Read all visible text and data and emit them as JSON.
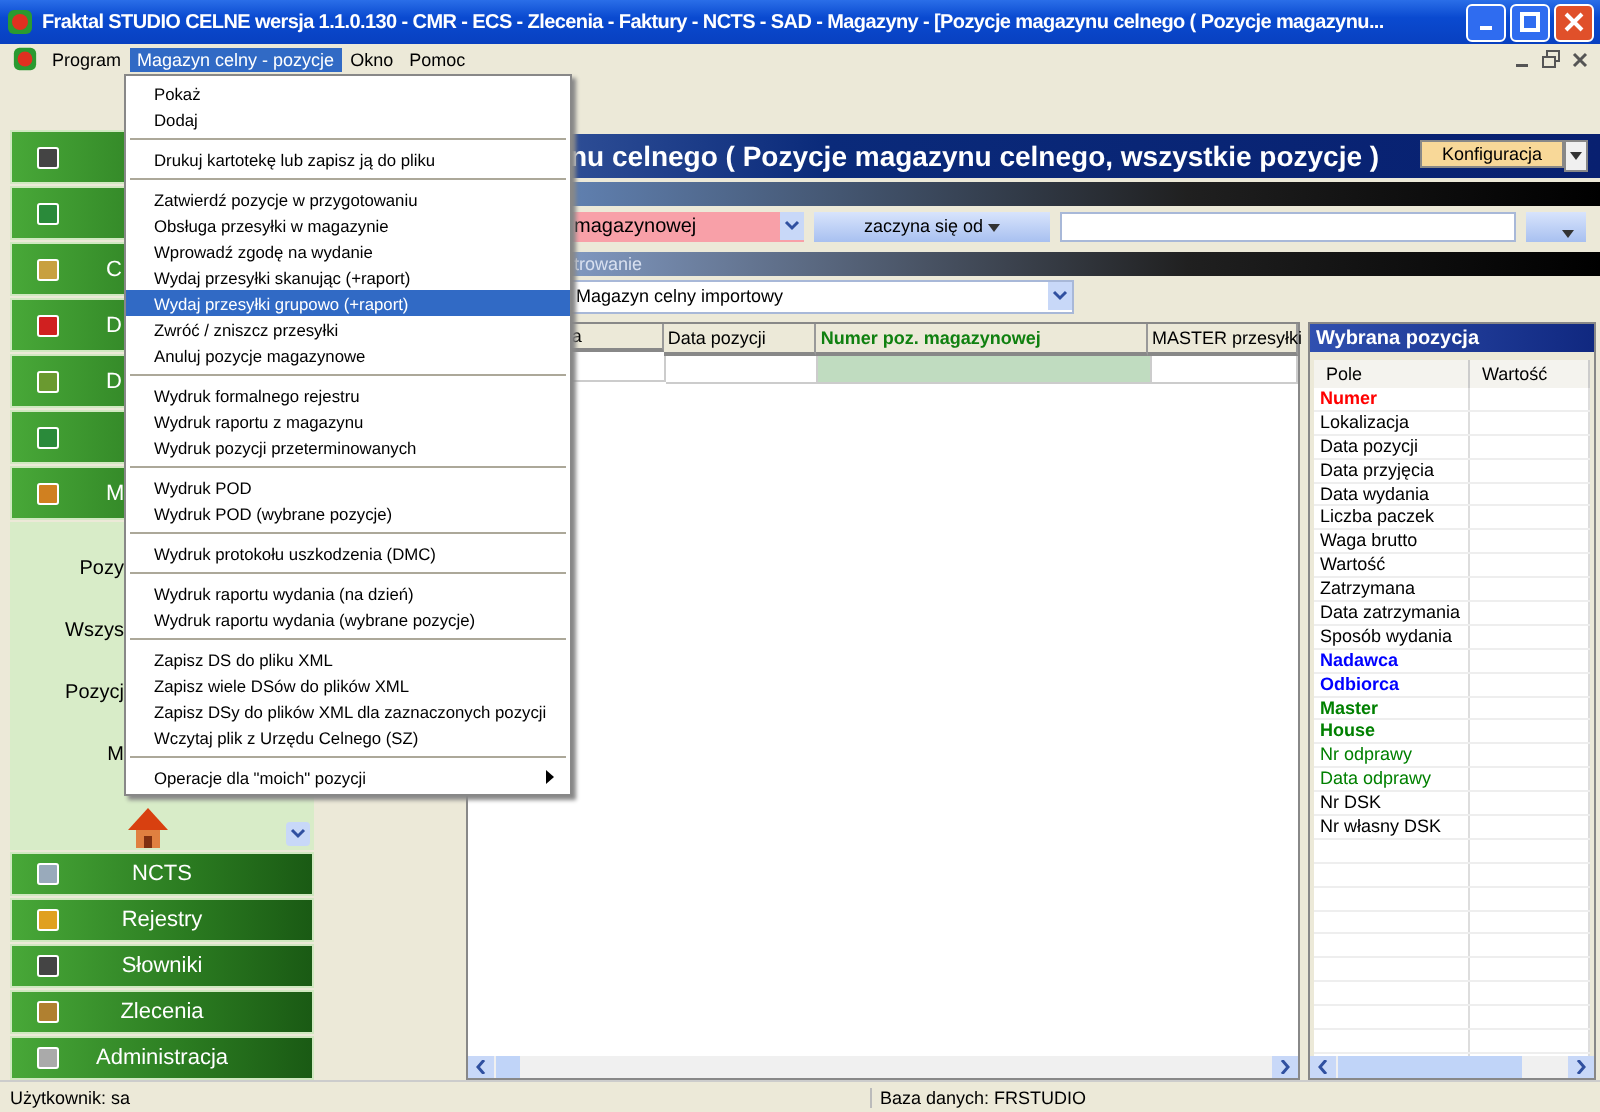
{
  "window": {
    "title": "Fraktal STUDIO CELNE  wersja 1.1.0.130 - CMR - ECS - Zlecenia - Faktury - NCTS - SAD - Magazyny - [Pozycje magazynu celnego ( Pozycje magazynu..."
  },
  "menubar": [
    {
      "label": "Program",
      "selected": false
    },
    {
      "label": "Magazyn celny - pozycje",
      "selected": true
    },
    {
      "label": "Okno",
      "selected": false
    },
    {
      "label": "Pomoc",
      "selected": false
    }
  ],
  "menu": {
    "groups": [
      [
        {
          "label": "Pokaż",
          "selected": false,
          "submenu": false
        },
        {
          "label": "Dodaj",
          "selected": false,
          "submenu": false
        }
      ],
      [
        {
          "label": "Drukuj kartotekę lub zapisz ją do pliku",
          "selected": false,
          "submenu": false
        }
      ],
      [
        {
          "label": "Zatwierdź pozycje w przygotowaniu",
          "selected": false,
          "submenu": false
        },
        {
          "label": "Obsługa przesyłki w magazynie",
          "selected": false,
          "submenu": false
        },
        {
          "label": "Wprowadź zgodę na wydanie",
          "selected": false,
          "submenu": false
        },
        {
          "label": "Wydaj przesyłki skanując (+raport)",
          "selected": false,
          "submenu": false
        },
        {
          "label": "Wydaj przesyłki grupowo (+raport)",
          "selected": true,
          "submenu": false
        },
        {
          "label": "Zwróć / zniszcz przesyłki",
          "selected": false,
          "submenu": false
        },
        {
          "label": "Anuluj pozycje magazynowe",
          "selected": false,
          "submenu": false
        }
      ],
      [
        {
          "label": "Wydruk formalnego rejestru",
          "selected": false,
          "submenu": false
        },
        {
          "label": "Wydruk raportu z magazynu",
          "selected": false,
          "submenu": false
        },
        {
          "label": "Wydruk pozycji przeterminowanych",
          "selected": false,
          "submenu": false
        }
      ],
      [
        {
          "label": "Wydruk POD",
          "selected": false,
          "submenu": false
        },
        {
          "label": "Wydruk POD (wybrane pozycje)",
          "selected": false,
          "submenu": false
        }
      ],
      [
        {
          "label": "Wydruk protokołu uszkodzenia (DMC)",
          "selected": false,
          "submenu": false
        }
      ],
      [
        {
          "label": "Wydruk raportu wydania (na dzień)",
          "selected": false,
          "submenu": false
        },
        {
          "label": "Wydruk raportu wydania (wybrane pozycje)",
          "selected": false,
          "submenu": false
        }
      ],
      [
        {
          "label": "Zapisz DS do pliku XML",
          "selected": false,
          "submenu": false
        },
        {
          "label": "Zapisz wiele DSów do plików XML",
          "selected": false,
          "submenu": false
        },
        {
          "label": "Zapisz DSy do plików XML dla zaznaczonych pozycji",
          "selected": false,
          "submenu": false
        },
        {
          "label": "Wczytaj plik z Urzędu Celnego (SZ)",
          "selected": false,
          "submenu": false
        }
      ],
      [
        {
          "label": "Operacje dla \"moich\" pozycji",
          "selected": false,
          "submenu": true
        }
      ]
    ]
  },
  "sidebar": {
    "top_buttons": [
      {
        "kind": "document"
      },
      {
        "kind": "picture"
      },
      {
        "kind": "bell",
        "label": "C"
      },
      {
        "kind": "cmr",
        "label": "D"
      },
      {
        "kind": "clipboard",
        "label": "D"
      },
      {
        "kind": "picture"
      },
      {
        "kind": "lock",
        "label": "M"
      }
    ],
    "panel_texts": [
      "Pozy",
      "Wszys",
      "Pozycj",
      "M"
    ],
    "bottom_buttons": [
      {
        "kind": "mail",
        "label": "NCTS"
      },
      {
        "kind": "register",
        "label": "Rejestry"
      },
      {
        "kind": "document",
        "label": "Słowniki"
      },
      {
        "kind": "box",
        "label": "Zlecenia"
      },
      {
        "kind": "tools",
        "label": "Administracja"
      }
    ]
  },
  "content": {
    "title": "nu celnego ( Pozycje magazynu celnego, wszystkie pozycje )",
    "config_button": "Konfiguracja",
    "filter": {
      "field": "magazynowej",
      "condition": "zaczyna się od"
    },
    "group_bar": "trowanie",
    "warehouse": "Magazyn celny importowy",
    "table": {
      "columns": [
        {
          "label": "a",
          "selected": false
        },
        {
          "label": "Data pozycji",
          "selected": false
        },
        {
          "label": "Numer poz. magazynowej",
          "selected": true
        },
        {
          "label": "MASTER przesyłki",
          "selected": false
        }
      ]
    },
    "details": {
      "title": "Wybrana pozycja",
      "columns": [
        "Pole",
        "Wartość"
      ],
      "fields": [
        {
          "label": "Numer",
          "color": "#ff0000",
          "bold": true
        },
        {
          "label": "Lokalizacja",
          "color": "#000000",
          "bold": false
        },
        {
          "label": "Data pozycji",
          "color": "#000000",
          "bold": false
        },
        {
          "label": "Data przyjęcia",
          "color": "#000000",
          "bold": false
        },
        {
          "label": "Data wydania",
          "color": "#000000",
          "bold": false
        },
        {
          "label": "Liczba paczek",
          "color": "#000000",
          "bold": false
        },
        {
          "label": "Waga brutto",
          "color": "#000000",
          "bold": false
        },
        {
          "label": "Wartość",
          "color": "#000000",
          "bold": false
        },
        {
          "label": "Zatrzymana",
          "color": "#000000",
          "bold": false
        },
        {
          "label": "Data zatrzymania",
          "color": "#000000",
          "bold": false
        },
        {
          "label": "Sposób wydania",
          "color": "#000000",
          "bold": false
        },
        {
          "label": "Nadawca",
          "color": "#0000ff",
          "bold": true
        },
        {
          "label": "Odbiorca",
          "color": "#0000ff",
          "bold": true
        },
        {
          "label": "Master",
          "color": "#008000",
          "bold": true
        },
        {
          "label": "House",
          "color": "#008000",
          "bold": true
        },
        {
          "label": "Nr odprawy",
          "color": "#008000",
          "bold": false
        },
        {
          "label": "Data odprawy",
          "color": "#008000",
          "bold": false
        },
        {
          "label": "Nr DSK",
          "color": "#000000",
          "bold": false
        },
        {
          "label": "Nr własny DSK",
          "color": "#000000",
          "bold": false
        }
      ]
    }
  },
  "status_bar": [
    "Użytkownik: sa",
    "Baza danych: FRSTUDIO"
  ]
}
